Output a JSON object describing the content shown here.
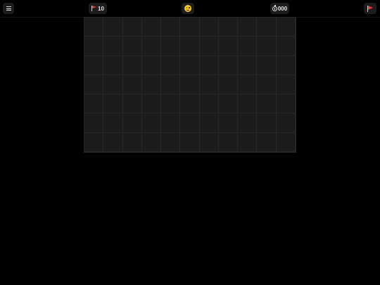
{
  "header": {
    "mines_remaining": "10",
    "timer": "000",
    "face_state": "neutral"
  },
  "icons": {
    "menu": "hamburger-icon",
    "mines_counter": "red-flag-icon",
    "face": "neutral-face-icon",
    "timer": "stopwatch-icon",
    "flag_mode": "red-flag-icon"
  },
  "colors": {
    "background": "#000000",
    "board": "#1a1a1a",
    "grid_line": "#272727",
    "pill": "#1c1c1c",
    "flag": "#e53935",
    "face": "#f3c623"
  },
  "board": {
    "cols": 11,
    "rows": 7,
    "state": "all-hidden"
  }
}
